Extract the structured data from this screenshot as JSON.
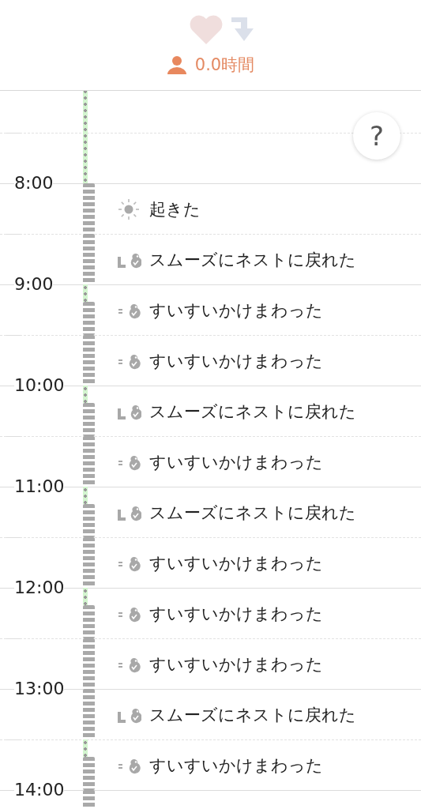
{
  "header": {
    "hours": "0.0時間"
  },
  "help_button": {
    "label": "?"
  },
  "slots": [
    {
      "kind": "hour",
      "asleep": true
    },
    {
      "kind": "half",
      "asleep": true
    },
    {
      "kind": "hour",
      "hour_label": "8:00",
      "asleep": false,
      "dozed": false,
      "event": {
        "kind": "wake",
        "text": "起きた"
      }
    },
    {
      "kind": "half",
      "asleep": false,
      "dozed": false,
      "event": {
        "kind": "nest",
        "text": "スムーズにネストに戻れた"
      }
    },
    {
      "kind": "hour",
      "hour_label": "9:00",
      "asleep": false,
      "dozed": true,
      "event": {
        "kind": "swim",
        "text": "すいすいかけまわった"
      }
    },
    {
      "kind": "half",
      "asleep": false,
      "dozed": false,
      "event": {
        "kind": "swim",
        "text": "すいすいかけまわった"
      }
    },
    {
      "kind": "hour",
      "hour_label": "10:00",
      "asleep": false,
      "dozed": true,
      "event": {
        "kind": "nest",
        "text": "スムーズにネストに戻れた"
      }
    },
    {
      "kind": "half",
      "asleep": false,
      "dozed": false,
      "event": {
        "kind": "swim",
        "text": "すいすいかけまわった"
      }
    },
    {
      "kind": "hour",
      "hour_label": "11:00",
      "asleep": false,
      "dozed": true,
      "event": {
        "kind": "nest",
        "text": "スムーズにネストに戻れた"
      }
    },
    {
      "kind": "half",
      "asleep": false,
      "dozed": false,
      "event": {
        "kind": "swim",
        "text": "すいすいかけまわった"
      }
    },
    {
      "kind": "hour",
      "hour_label": "12:00",
      "asleep": false,
      "dozed": true,
      "event": {
        "kind": "swim",
        "text": "すいすいかけまわった"
      }
    },
    {
      "kind": "half",
      "asleep": false,
      "dozed": false,
      "event": {
        "kind": "swim",
        "text": "すいすいかけまわった"
      }
    },
    {
      "kind": "hour",
      "hour_label": "13:00",
      "asleep": false,
      "dozed": false,
      "event": {
        "kind": "nest",
        "text": "スムーズにネストに戻れた"
      }
    },
    {
      "kind": "half",
      "asleep": false,
      "dozed": true,
      "event": {
        "kind": "swim",
        "text": "すいすいかけまわった"
      }
    },
    {
      "kind": "hour",
      "hour_label": "14:00",
      "asleep": false,
      "dozed": false
    }
  ]
}
